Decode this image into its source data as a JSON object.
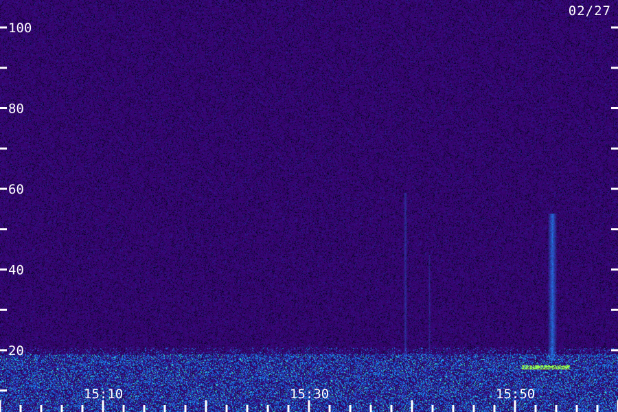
{
  "chart_data": {
    "type": "heatmap",
    "title": "",
    "xlabel": "",
    "ylabel": "",
    "date": "02/27",
    "x_ticks": [
      "15:10",
      "15:30",
      "15:50"
    ],
    "y_ticks": [
      100,
      80,
      60,
      40,
      20
    ],
    "ylim": [
      0,
      110
    ],
    "grid": false,
    "legend": "none",
    "colors": {
      "background": "#2a0a8a",
      "noise_high": "#3a1ab0",
      "band": "#1e90ff",
      "band_hot": "#40ffb0",
      "text": "#ffffff"
    }
  }
}
